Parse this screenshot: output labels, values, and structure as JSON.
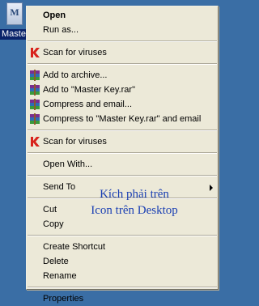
{
  "desktop": {
    "icon_glyph": "M",
    "icon_label": "Master Key"
  },
  "menu": {
    "open": "Open",
    "run_as": "Run as...",
    "scan_viruses_1": "Scan for viruses",
    "add_to_archive": "Add to archive...",
    "add_to_rar": "Add to \"Master Key.rar\"",
    "compress_email": "Compress and email...",
    "compress_rar_email": "Compress to \"Master Key.rar\" and email",
    "scan_viruses_2": "Scan for viruses",
    "open_with": "Open With...",
    "send_to": "Send To",
    "cut": "Cut",
    "copy": "Copy",
    "create_shortcut": "Create Shortcut",
    "delete": "Delete",
    "rename": "Rename",
    "properties": "Properties"
  },
  "annotation": {
    "line1": "Kích phải trên",
    "line2": "Icon trên Desktop"
  },
  "icons": {
    "antivirus": "kaspersky-k-icon",
    "archive": "winrar-books-icon"
  },
  "colors": {
    "desktop": "#3a6ea5",
    "menu_bg": "#ece9d8",
    "selection": "#0a246a",
    "annotation": "#1a3fb3"
  }
}
